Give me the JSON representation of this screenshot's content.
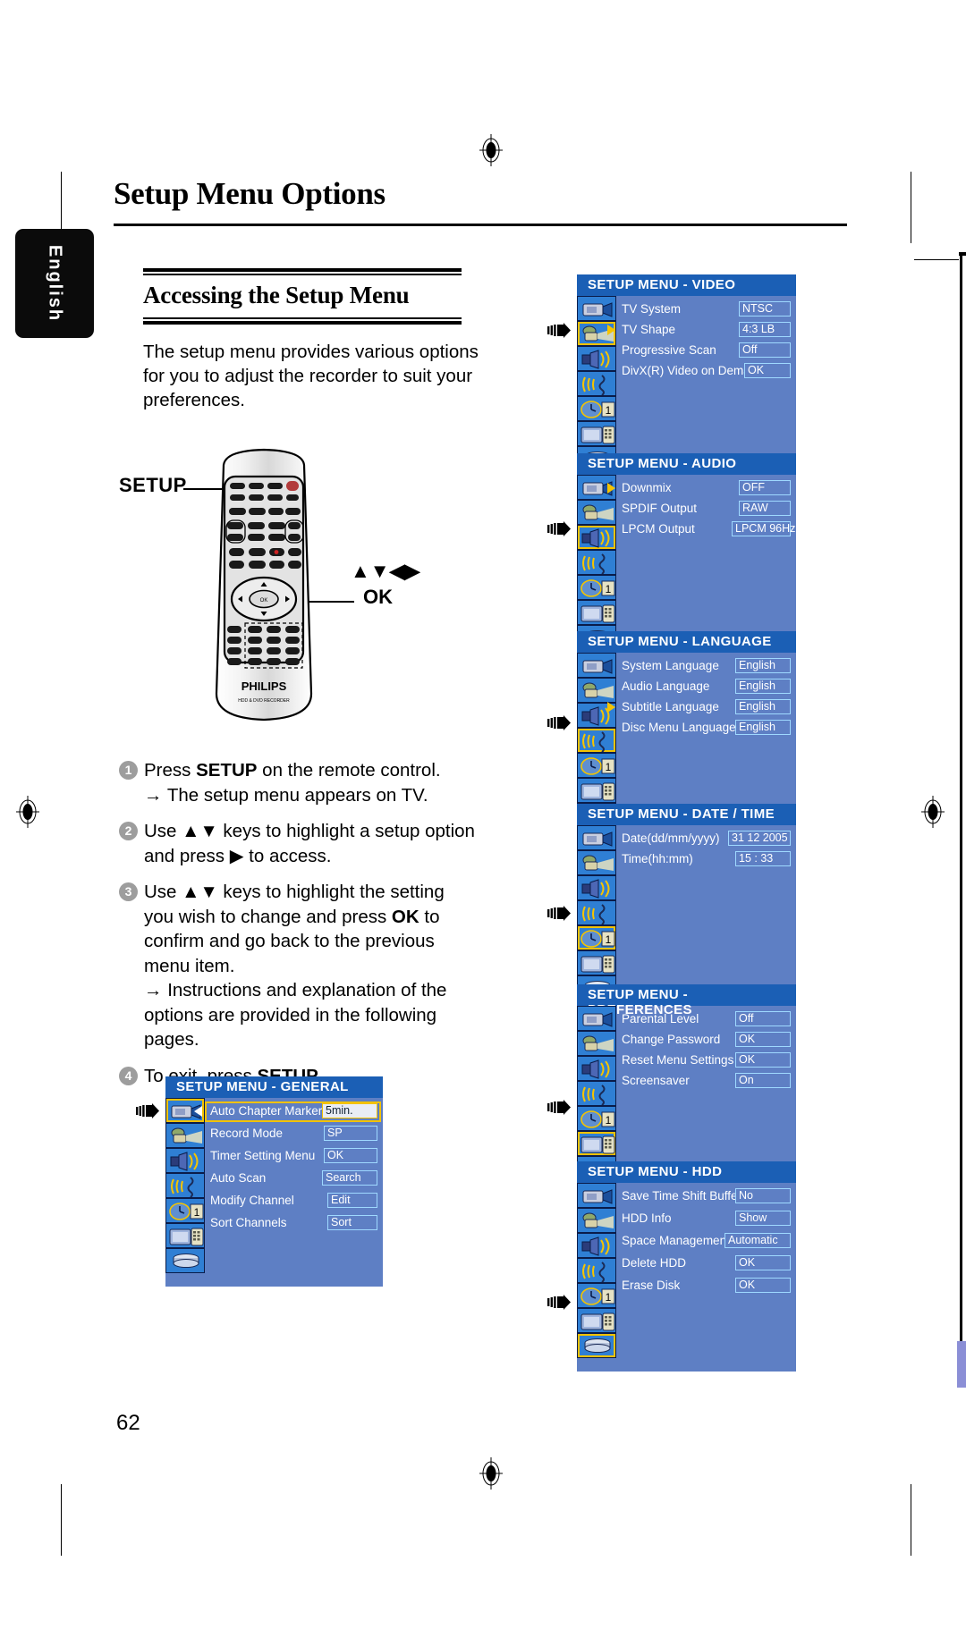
{
  "document": {
    "language_tab": "English",
    "page_title": "Setup Menu Options",
    "section_title": "Accessing the Setup Menu",
    "intro": "The setup menu provides various options for you to adjust the recorder to suit your preferences.",
    "page_number": "62"
  },
  "remote": {
    "setup_label": "SETUP",
    "nav_label": "▲▼◀▶",
    "ok_label": "OK",
    "brand": "PHILIPS",
    "brand_sub": "HDD & DVD RECORDER"
  },
  "steps": [
    {
      "num": "1",
      "text_before": "Press ",
      "bold": "SETUP",
      "text_after": " on the remote control.",
      "note": "→ The setup menu appears on TV."
    },
    {
      "num": "2",
      "text_before": "Use ▲▼ keys to highlight a setup option and press ▶ to access.",
      "bold": "",
      "text_after": "",
      "note": ""
    },
    {
      "num": "3",
      "text_before": "Use ▲▼ keys to highlight the setting you wish to change and press ",
      "bold": "OK",
      "text_after": " to confirm and go back to the previous menu item.",
      "note": "→ Instructions and explanation of the options are provided in the following pages."
    },
    {
      "num": "4",
      "text_before": "To exit, press ",
      "bold": "SETUP",
      "text_after": ".",
      "note": ""
    }
  ],
  "colors": {
    "osd_header": "#1b5fb5",
    "osd_body": "#5e7fc4",
    "osd_value_border": "#9fd9ff",
    "caret_yellow": "#f5c400",
    "highlight_yellow": "#f2c200"
  },
  "osd_icons": [
    "camcorder-icon",
    "film-projector-icon",
    "speaker-icon",
    "waveform-icon",
    "clock-one-icon",
    "tv-keypad-icon",
    "hdd-disc-icon"
  ],
  "menus": [
    {
      "id": "video",
      "title": "SETUP MENU - VIDEO",
      "selected_icon": 1,
      "caret_row": 1,
      "rows": [
        {
          "label": "TV System",
          "value": "NTSC"
        },
        {
          "label": "TV Shape",
          "value": "4:3 LB"
        },
        {
          "label": "Progressive Scan",
          "value": "Off"
        },
        {
          "label": "DivX(R) Video on Demand",
          "value": "OK"
        }
      ]
    },
    {
      "id": "audio",
      "title": "SETUP MENU - AUDIO",
      "selected_icon": 2,
      "caret_row": 0,
      "rows": [
        {
          "label": "Downmix",
          "value": "OFF"
        },
        {
          "label": "SPDIF Output",
          "value": "RAW"
        },
        {
          "label": "LPCM Output",
          "value": "LPCM 96Hz"
        }
      ]
    },
    {
      "id": "language",
      "title": "SETUP MENU - LANGUAGE",
      "selected_icon": 3,
      "caret_row": 2,
      "rows": [
        {
          "label": "System Language",
          "value": "English"
        },
        {
          "label": "Audio Language",
          "value": "English"
        },
        {
          "label": "Subtitle Language",
          "value": "English"
        },
        {
          "label": "Disc Menu Language",
          "value": "English"
        }
      ]
    },
    {
      "id": "datetime",
      "title": "SETUP MENU - DATE / TIME",
      "selected_icon": 4,
      "caret_row": -1,
      "rows": [
        {
          "label": "Date(dd/mm/yyyy)",
          "value": "31 12 2005"
        },
        {
          "label": "Time(hh:mm)",
          "value": "15 : 33"
        }
      ]
    },
    {
      "id": "preferences",
      "title": "SETUP MENU - PREFERENCES",
      "selected_icon": 5,
      "caret_row": -1,
      "rows": [
        {
          "label": "Parental Level",
          "value": "Off"
        },
        {
          "label": "Change Password",
          "value": "OK"
        },
        {
          "label": "Reset Menu Settings",
          "value": "OK"
        },
        {
          "label": "Screensaver",
          "value": "On"
        }
      ]
    },
    {
      "id": "hdd",
      "title": "SETUP MENU - HDD",
      "selected_icon": 6,
      "caret_row": -1,
      "rows": [
        {
          "label": "Save Time Shift Buffer",
          "value": "No"
        },
        {
          "label": "HDD Info",
          "value": "Show"
        },
        {
          "label": "Space Management",
          "value": "Automatic"
        },
        {
          "label": "Delete HDD",
          "value": "OK"
        },
        {
          "label": "Erase Disk",
          "value": "OK"
        }
      ]
    },
    {
      "id": "general",
      "title": "SETUP MENU - GENERAL",
      "selected_icon": 0,
      "caret_row": 0,
      "caret_dir": "left",
      "rows": [
        {
          "label": "Auto Chapter Marker",
          "value": "5min.",
          "highlight": true
        },
        {
          "label": "Record Mode",
          "value": "SP"
        },
        {
          "label": "Timer Setting Menu",
          "value": "OK"
        },
        {
          "label": "Auto Scan",
          "value": "Search"
        },
        {
          "label": "Modify Channel",
          "value": "Edit"
        },
        {
          "label": "Sort Channels",
          "value": "Sort"
        }
      ]
    }
  ]
}
